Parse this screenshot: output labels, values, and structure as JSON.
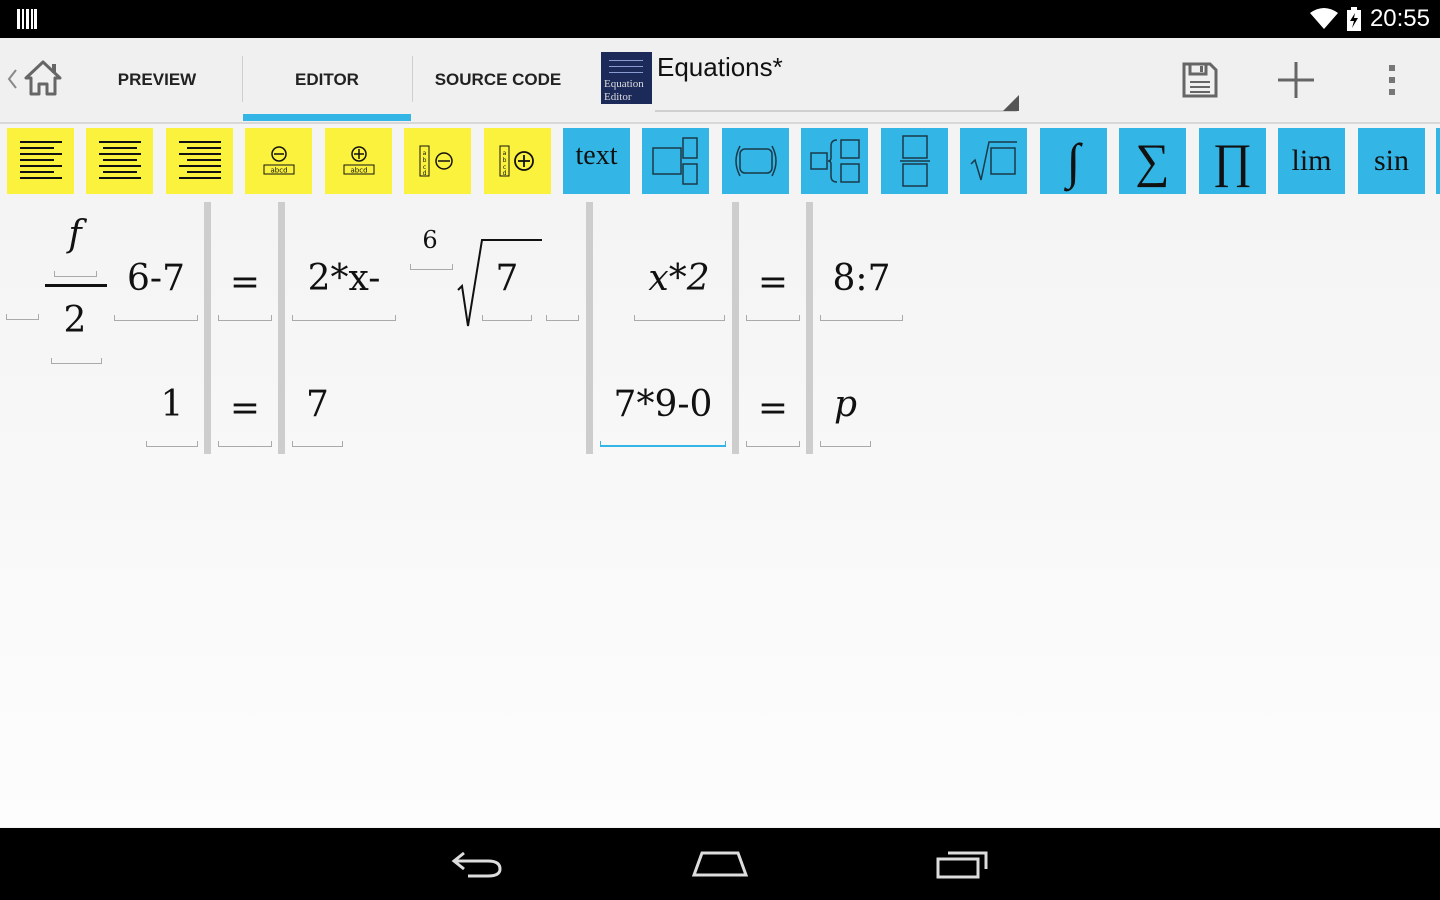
{
  "status_bar": {
    "clock": "20:55",
    "icons": [
      "barcode-icon",
      "wifi-icon",
      "battery-charging-icon"
    ]
  },
  "action_bar": {
    "tabs": [
      {
        "label": "PREVIEW",
        "selected": false
      },
      {
        "label": "EDITOR",
        "selected": true
      },
      {
        "label": "SOURCE CODE",
        "selected": false
      }
    ],
    "document": {
      "logo_line1": "Equation",
      "logo_line2": "Editor",
      "title": "Equations*"
    },
    "actions": [
      "save-icon",
      "add-icon",
      "overflow-menu-icon"
    ]
  },
  "toolbar": {
    "colors": {
      "layout_group": "#fbf23d",
      "insert_group": "#33b5e5",
      "accent": "#33b5e5"
    },
    "layout_buttons": [
      "align-left-icon",
      "align-center-icon",
      "align-right-icon",
      "remove-row-icon",
      "add-row-icon",
      "remove-column-icon",
      "add-column-icon"
    ],
    "row_label": "abcd",
    "insert_buttons": [
      {
        "icon": "text-icon",
        "label": "text"
      },
      {
        "icon": "subscript-superscript-icon",
        "label": ""
      },
      {
        "icon": "parentheses-icon",
        "label": ""
      },
      {
        "icon": "brace-case-icon",
        "label": ""
      },
      {
        "icon": "fraction-icon",
        "label": ""
      },
      {
        "icon": "square-root-icon",
        "label": "√"
      },
      {
        "icon": "integral-icon",
        "label": "∫"
      },
      {
        "icon": "sum-icon",
        "label": "∑"
      },
      {
        "icon": "product-icon",
        "label": "∏"
      },
      {
        "icon": "limit-icon",
        "label": "lim"
      },
      {
        "icon": "sine-icon",
        "label": "sin"
      }
    ]
  },
  "editor": {
    "row1": {
      "fraction_numerator": "f",
      "fraction_denominator": "2",
      "term": "6-7",
      "equals1": "=",
      "rhs": "2*x-",
      "root_index": "6",
      "root_radicand": "7",
      "lhs2": "x*2",
      "equals2": "=",
      "rhs2": "8:7"
    },
    "row2": {
      "lhs": "1",
      "equals1": "=",
      "rhs": "7",
      "lhs2": "7*9-0",
      "equals2": "=",
      "rhs2": "p"
    }
  },
  "nav_bar": {
    "buttons": [
      "back-icon",
      "home-icon",
      "recent-apps-icon"
    ]
  }
}
